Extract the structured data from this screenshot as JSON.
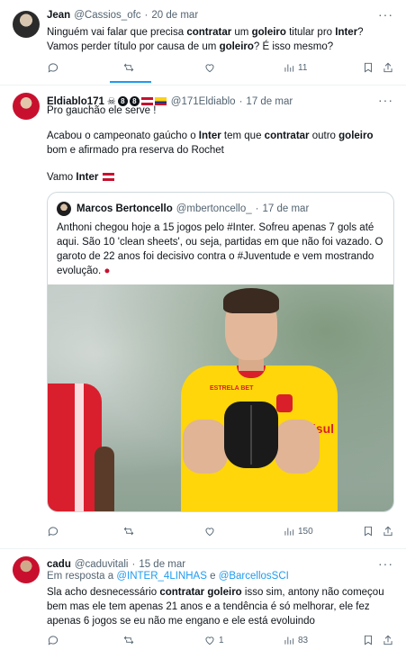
{
  "tweets": [
    {
      "name": "Jean",
      "handle": "@Cassios_ofc",
      "date": "20 de mar",
      "text_html": "Ninguém vai falar que precisa <b>contratar</b> um <b>goleiro</b> titular pro <b>Inter</b>? Vamos perder título por causa de um <b>goleiro</b>? É isso mesmo?",
      "views": "11"
    },
    {
      "name": "Eldiablo171",
      "handle": "@171Eldiablo",
      "date": "17 de mar",
      "line1": "Pro gauchão ele serve !",
      "line2_html": "Acabou o campeonato gaúcho o <b>Inter</b> tem que <b>contratar</b> outro <b>goleiro</b> bom e afirmado pra reserva do Rochet",
      "line3_html": "Vamo <b>Inter</b>",
      "quote": {
        "name": "Marcos Bertoncello",
        "handle": "@mbertoncello_",
        "date": "17 de mar",
        "text": "Anthoni chegou hoje a 15 jogos pelo #Inter. Sofreu apenas 7 gols até aqui. São 10 'clean sheets', ou seja, partidas em que não foi vazado. O garoto de 22 anos foi decisivo contra o #Juventude e vem mostrando evolução.",
        "image_texts": {
          "logo": "Banrisul",
          "sponsor": "ESTRELA BET"
        }
      },
      "views": "150"
    },
    {
      "name": "cadu",
      "handle": "@caduvitali",
      "date": "15 de mar",
      "reply_prefix": "Em resposta a",
      "reply_to_1": "@INTER_4LINHAS",
      "reply_and": "e",
      "reply_to_2": "@BarcellosSCI",
      "text_html": "Sla acho desnecessário <b>contratar goleiro</b> isso sim, antony não começou bem mas ele tem apenas 21 anos e a tendência é só melhorar, ele fez apenas 6 jogos se eu não me engano e ele está evoluindo",
      "likes": "1",
      "views": "83"
    }
  ],
  "icons": [
    "more-icon",
    "reply-icon",
    "retweet-icon",
    "like-icon",
    "views-icon",
    "bookmark-icon",
    "share-icon"
  ],
  "colors": {
    "accent": "#1d9bf0",
    "text": "#0f1419",
    "muted": "#536471",
    "border": "#eff3f4"
  }
}
